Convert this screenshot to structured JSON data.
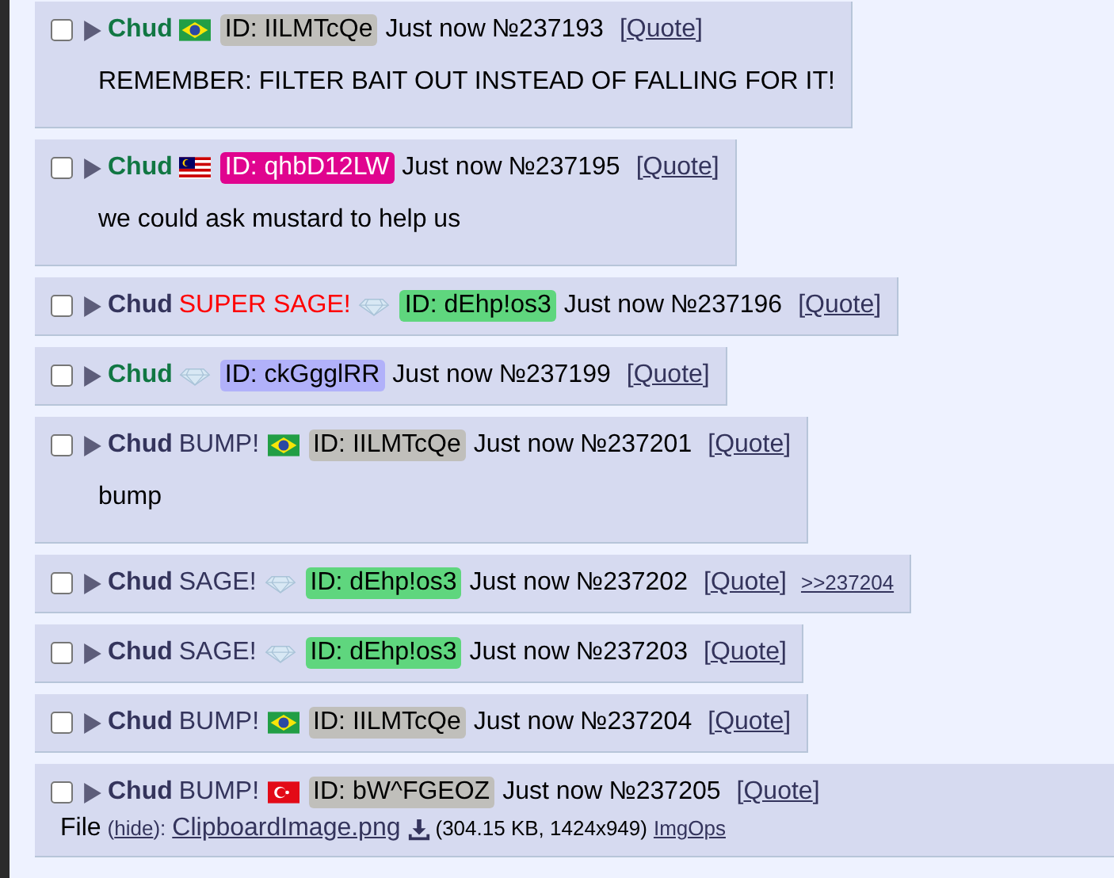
{
  "posts": [
    {
      "checked": false,
      "name": "Chud",
      "flag": {
        "kind": "brazil"
      },
      "id": {
        "text": "ID: IILMTcQe",
        "color": "#c0bfbb"
      },
      "time": "Just now",
      "number": "№237193",
      "quote": {
        "open": "[",
        "label": "Quote",
        "close": "]"
      },
      "message": "REMEMBER: FILTER BAIT OUT INSTEAD OF FALLING FOR IT!"
    },
    {
      "checked": false,
      "name": "Chud",
      "flag": {
        "kind": "malaysia"
      },
      "id": {
        "text": "ID: qhbD12LW",
        "color": "#e0048f"
      },
      "time": "Just now",
      "number": "№237195",
      "quote": {
        "open": "[",
        "label": "Quote",
        "close": "]"
      },
      "message": "we could ask mustard to help us"
    },
    {
      "checked": false,
      "name": "Chud",
      "email": {
        "text": "SUPER SAGE!",
        "kind": "super"
      },
      "flag": {
        "kind": "diamond"
      },
      "id": {
        "text": "ID: dEhp!os3",
        "color": "#5fd67e"
      },
      "time": "Just now",
      "number": "№237196",
      "quote": {
        "open": "[",
        "label": "Quote",
        "close": "]"
      }
    },
    {
      "checked": false,
      "name": "Chud",
      "flag": {
        "kind": "diamond"
      },
      "id": {
        "text": "ID: ckGgglRR",
        "color": "#b1b1fa"
      },
      "time": "Just now",
      "number": "№237199",
      "quote": {
        "open": "[",
        "label": "Quote",
        "close": "]"
      }
    },
    {
      "checked": false,
      "name": "Chud",
      "email": {
        "text": "BUMP!",
        "kind": "normal"
      },
      "flag": {
        "kind": "brazil"
      },
      "id": {
        "text": "ID: IILMTcQe",
        "color": "#c0bfbb"
      },
      "time": "Just now",
      "number": "№237201",
      "quote": {
        "open": "[",
        "label": "Quote",
        "close": "]"
      },
      "message": "bump"
    },
    {
      "checked": false,
      "name": "Chud",
      "email": {
        "text": "SAGE!",
        "kind": "normal"
      },
      "flag": {
        "kind": "diamond"
      },
      "id": {
        "text": "ID: dEhp!os3",
        "color": "#5fd67e"
      },
      "time": "Just now",
      "number": "№237202",
      "quote": {
        "open": "[",
        "label": "Quote",
        "close": "]"
      },
      "replies": [
        ">>237204"
      ]
    },
    {
      "checked": false,
      "name": "Chud",
      "email": {
        "text": "SAGE!",
        "kind": "normal"
      },
      "flag": {
        "kind": "diamond"
      },
      "id": {
        "text": "ID: dEhp!os3",
        "color": "#5fd67e"
      },
      "time": "Just now",
      "number": "№237203",
      "quote": {
        "open": "[",
        "label": "Quote",
        "close": "]"
      }
    },
    {
      "checked": false,
      "name": "Chud",
      "email": {
        "text": "BUMP!",
        "kind": "normal"
      },
      "flag": {
        "kind": "brazil"
      },
      "id": {
        "text": "ID: IILMTcQe",
        "color": "#c0bfbb"
      },
      "time": "Just now",
      "number": "№237204",
      "quote": {
        "open": "[",
        "label": "Quote",
        "close": "]"
      }
    },
    {
      "checked": false,
      "name": "Chud",
      "email": {
        "text": "BUMP!",
        "kind": "normal"
      },
      "flag": {
        "kind": "turkey"
      },
      "id": {
        "text": "ID: bW^FGEOZ",
        "color": "#c0bfbb"
      },
      "time": "Just now",
      "number": "№237205",
      "quote": {
        "open": "[",
        "label": "Quote",
        "close": "]"
      },
      "file": {
        "label": "File",
        "hide_open": "(",
        "hide": "hide",
        "hide_close": "):",
        "name": "ClipboardImage.png",
        "info": "(304.15 KB, 1424x949)",
        "ops": "ImgOps"
      }
    }
  ]
}
